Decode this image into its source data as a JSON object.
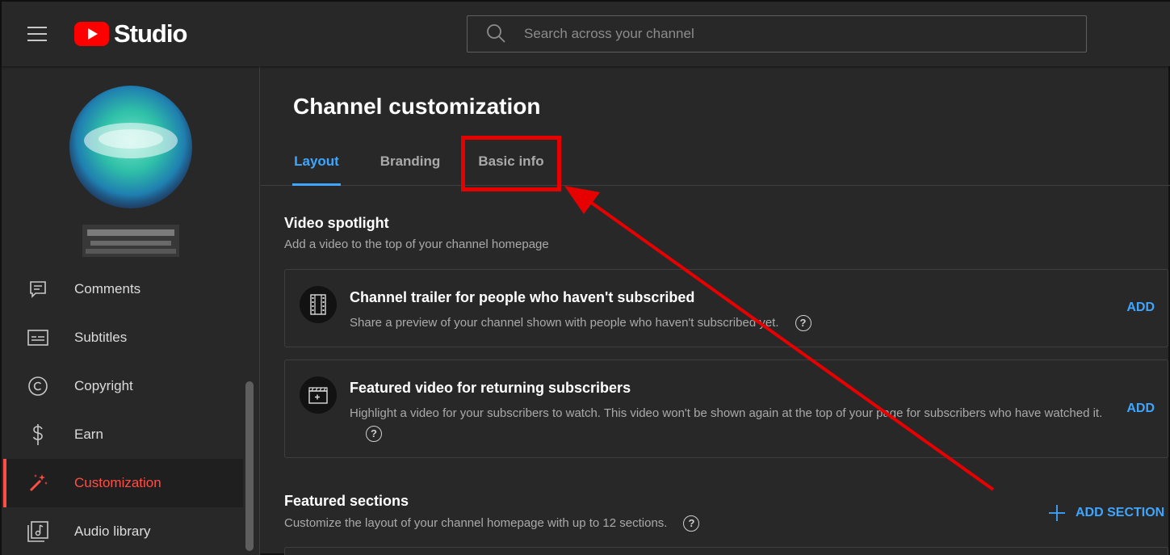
{
  "app": {
    "logo_text": "Studio",
    "brand_color": "#ff0000"
  },
  "search": {
    "placeholder": "Search across your channel"
  },
  "sidebar": {
    "items": [
      {
        "label": "Comments",
        "icon": "comment-icon"
      },
      {
        "label": "Subtitles",
        "icon": "subtitles-icon"
      },
      {
        "label": "Copyright",
        "icon": "copyright-icon"
      },
      {
        "label": "Earn",
        "icon": "dollar-icon"
      },
      {
        "label": "Customization",
        "icon": "magic-wand-icon",
        "active": true
      },
      {
        "label": "Audio library",
        "icon": "audio-library-icon"
      }
    ]
  },
  "main": {
    "title": "Channel customization",
    "tabs": [
      {
        "label": "Layout",
        "active": true
      },
      {
        "label": "Branding"
      },
      {
        "label": "Basic info"
      }
    ],
    "video_spotlight": {
      "title": "Video spotlight",
      "subtitle": "Add a video to the top of your channel homepage",
      "cards": [
        {
          "title": "Channel trailer for people who haven't subscribed",
          "description": "Share a preview of your channel shown with people who haven't subscribed yet.",
          "action": "ADD"
        },
        {
          "title": "Featured video for returning subscribers",
          "description": "Highlight a video for your subscribers to watch. This video won't be shown again at the top of your page for subscribers who have watched it.",
          "action": "ADD"
        }
      ]
    },
    "featured_sections": {
      "title": "Featured sections",
      "subtitle": "Customize the layout of your channel homepage with up to 12 sections.",
      "action": "ADD SECTION"
    }
  },
  "colors": {
    "accent": "#3ea6ff",
    "active_nav": "#ff4e45",
    "annotation": "#e60000"
  }
}
